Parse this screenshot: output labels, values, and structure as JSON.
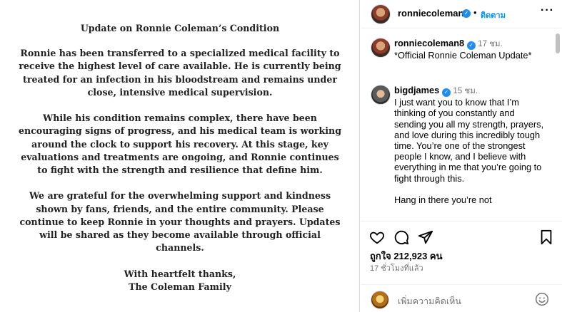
{
  "post": {
    "title": "Update on Ronnie Coleman’s Condition",
    "paragraphs": [
      "Ronnie has been transferred to a specialized medical facility to receive the highest level of care available. He is currently being treated for an infection in his bloodstream and remains under close, intensive medical supervision.",
      "While his condition remains complex, there have been encouraging signs of progress, and his medical team is working around the clock to support his recovery. At this stage, key evaluations and treatments are ongoing, and Ronnie continues to fight with the strength and resilience that define him.",
      "We are grateful for the overwhelming support and kindness shown by fans, friends, and the entire community. Please continue to keep Ronnie in your thoughts and prayers. Updates will be shared as they become available through official channels."
    ],
    "signoff_1": "With heartfelt thanks,",
    "signoff_2": "The Coleman Family"
  },
  "header": {
    "username": "ronniecoleman8",
    "dot": "•",
    "follow_label": "ติดตาม",
    "more_icon": "more-horizontal-icon"
  },
  "comments": [
    {
      "username": "ronniecoleman8",
      "time": "17 ชม.",
      "text": "*Official Ronnie Coleman Update*"
    },
    {
      "username": "bigdjames",
      "time": "15 ชม.",
      "text": "I just want you to know that I’m thinking of you constantly and sending you all my strength, prayers, and love during this incredibly tough time. You’re one of the strongest people I know, and I believe with everything in me that you’re going to fight through this.",
      "text_more": "Hang in there you’re not"
    }
  ],
  "actions": {
    "likes": "ถูกใจ 212,923 คน",
    "time_ago": "17 ชั่วโมงที่แล้ว"
  },
  "add_comment": {
    "placeholder": "เพิ่มความคิดเห็น"
  },
  "colors": {
    "accent": "#0095f6",
    "verified": "#1e8cf3",
    "muted": "#737373"
  }
}
